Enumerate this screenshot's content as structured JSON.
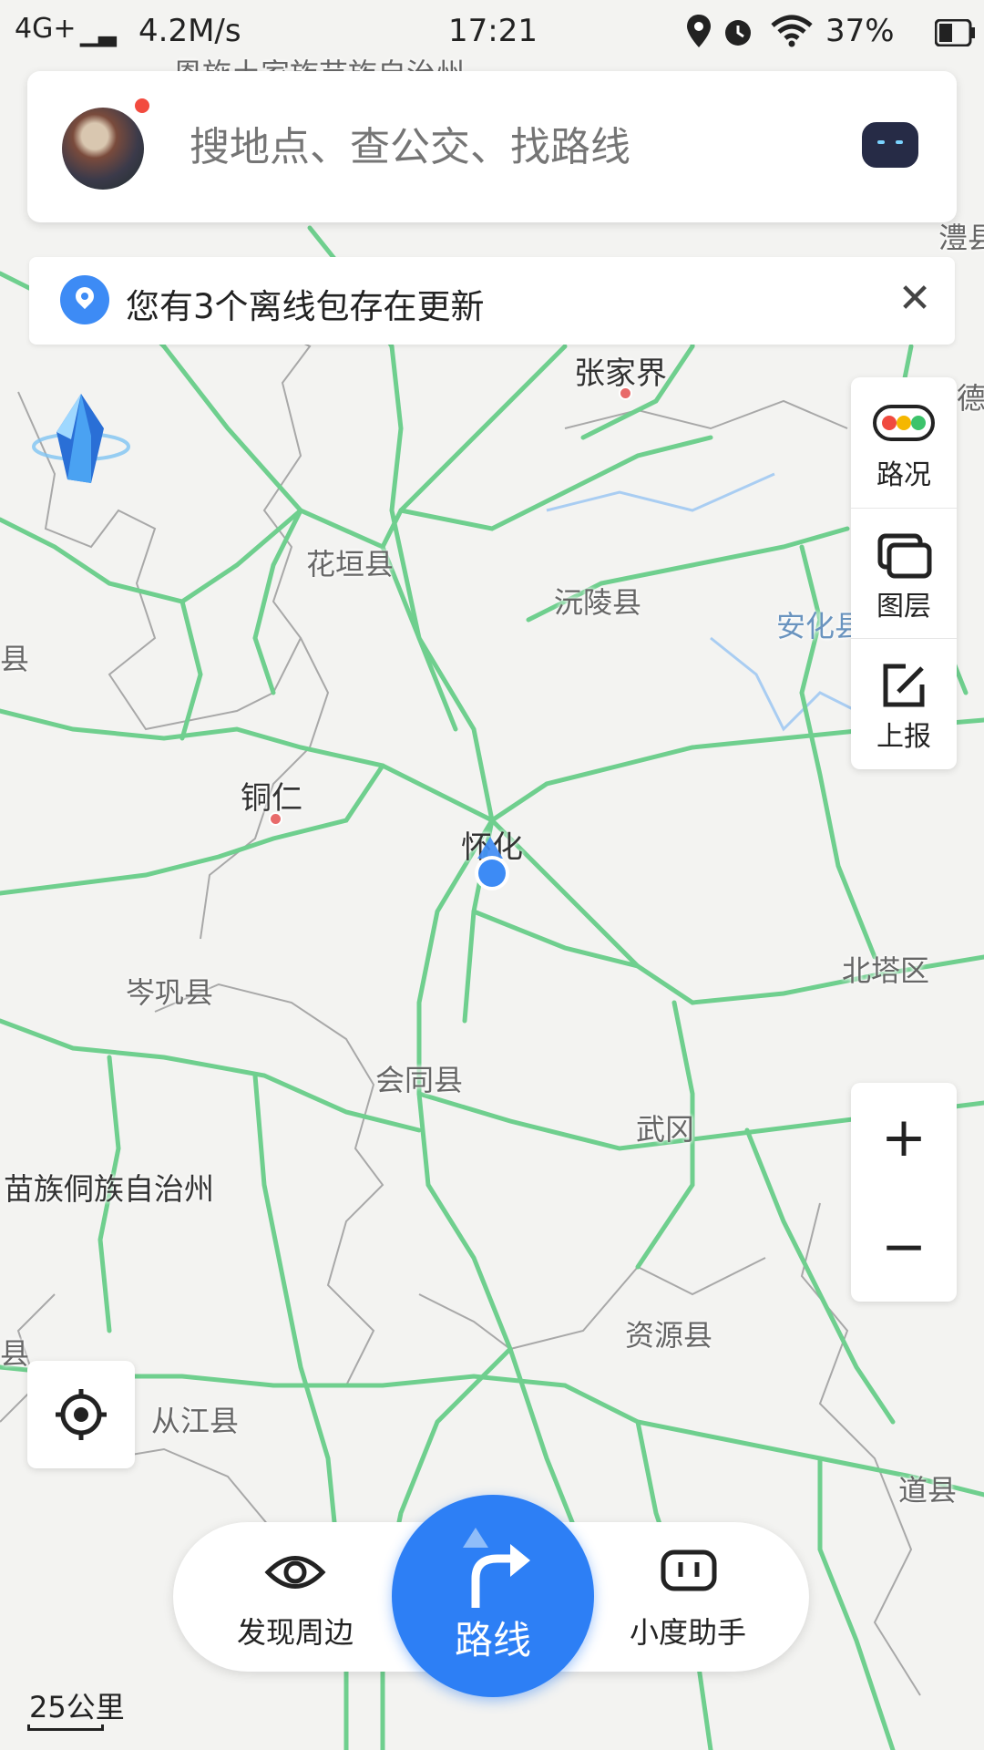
{
  "status_bar": {
    "network": "4G+",
    "speed": "4.2M/s",
    "time": "17:21",
    "battery": "37%"
  },
  "search": {
    "placeholder": "搜地点、查公交、找路线"
  },
  "notice": {
    "text": "您有3个离线包存在更新"
  },
  "map": {
    "labels": {
      "top_region": "恩施土家族苗族自治州",
      "lixian": "澧县",
      "zhangjiajie": "张家界",
      "de": "德",
      "huayuan": "花垣县",
      "yuanling": "沅陵县",
      "anhua": "安化县",
      "xian_left": "县",
      "tongren": "铜仁",
      "huaihua": "怀化",
      "beita": "北塔区",
      "cengong": "岑巩县",
      "huitong": "会同县",
      "wugang": "武冈",
      "miao_dong": "苗族侗族自治州",
      "ziyuan": "资源县",
      "xian_left2": "县",
      "congjiang": "从江县",
      "daoxian": "道县"
    }
  },
  "tools": {
    "traffic": "路况",
    "layers": "图层",
    "report": "上报"
  },
  "zoom": {
    "in": "+",
    "out": "−"
  },
  "bottom_bar": {
    "discover": "发现周边",
    "route": "路线",
    "assistant": "小度助手"
  },
  "scale": {
    "text": "25公里"
  },
  "colors": {
    "road": "#6fcf8e",
    "accent": "#2d7ff5",
    "border": "#9a9a9a",
    "water": "#a9cdf2"
  }
}
